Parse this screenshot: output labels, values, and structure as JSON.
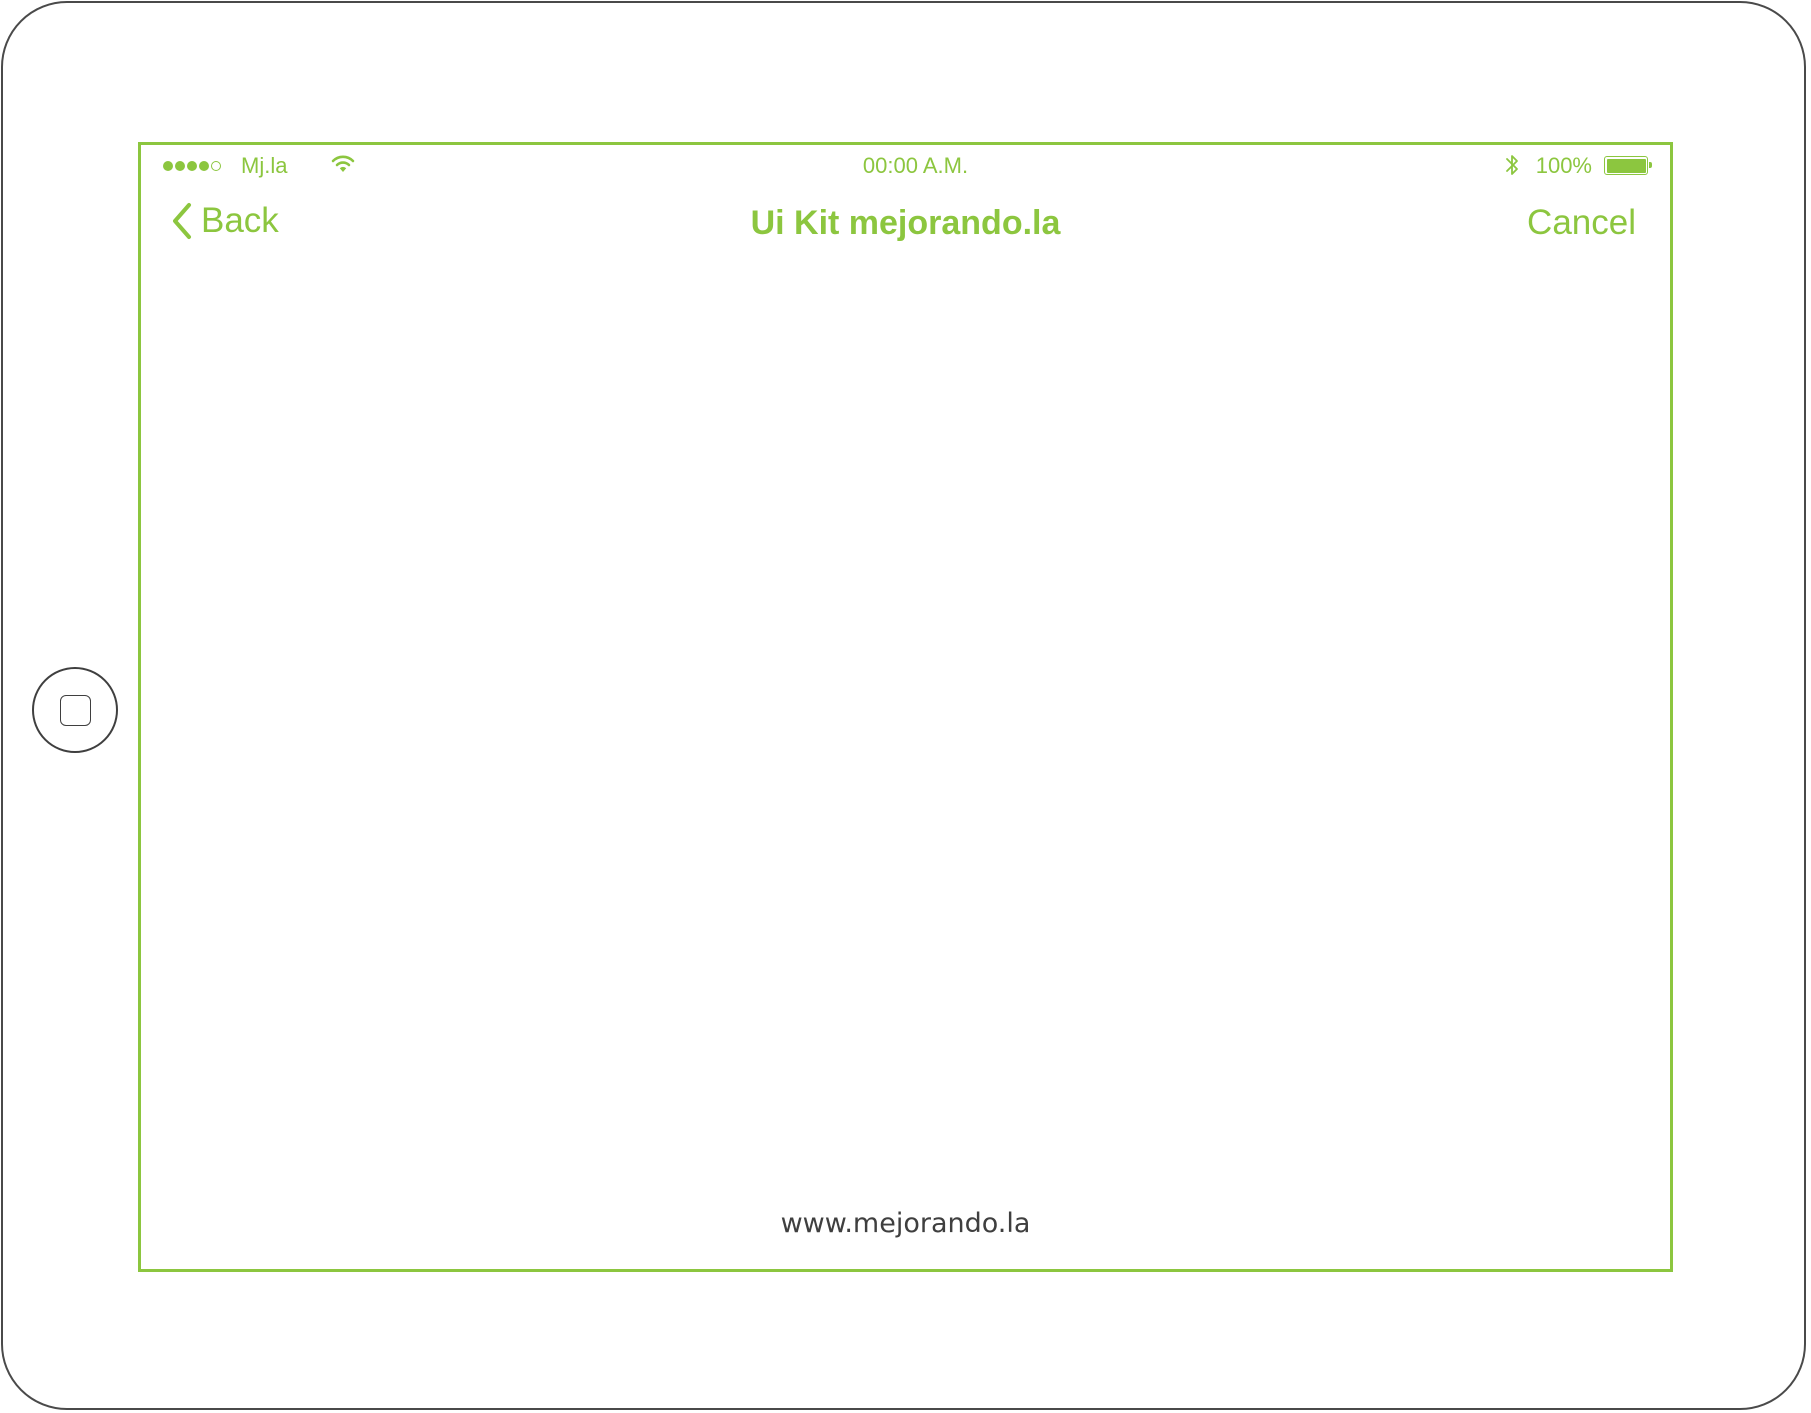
{
  "status_bar": {
    "signal_bars": 4,
    "signal_total": 5,
    "carrier": "Mj.la",
    "wifi_icon": "wifi-icon",
    "time": "00:00 A.M.",
    "bluetooth_icon": "bluetooth-icon",
    "battery_percent": "100%",
    "battery_level": 1.0
  },
  "nav_bar": {
    "back_label": "Back",
    "back_icon": "chevron-left-icon",
    "title": "Ui Kit mejorando.la",
    "cancel_label": "Cancel"
  },
  "footer": {
    "url": "www.mejorando.la"
  },
  "colors": {
    "accent": "#8cc63f",
    "device_outline": "#4a4a4a",
    "footer_text": "#3f3f3f"
  }
}
